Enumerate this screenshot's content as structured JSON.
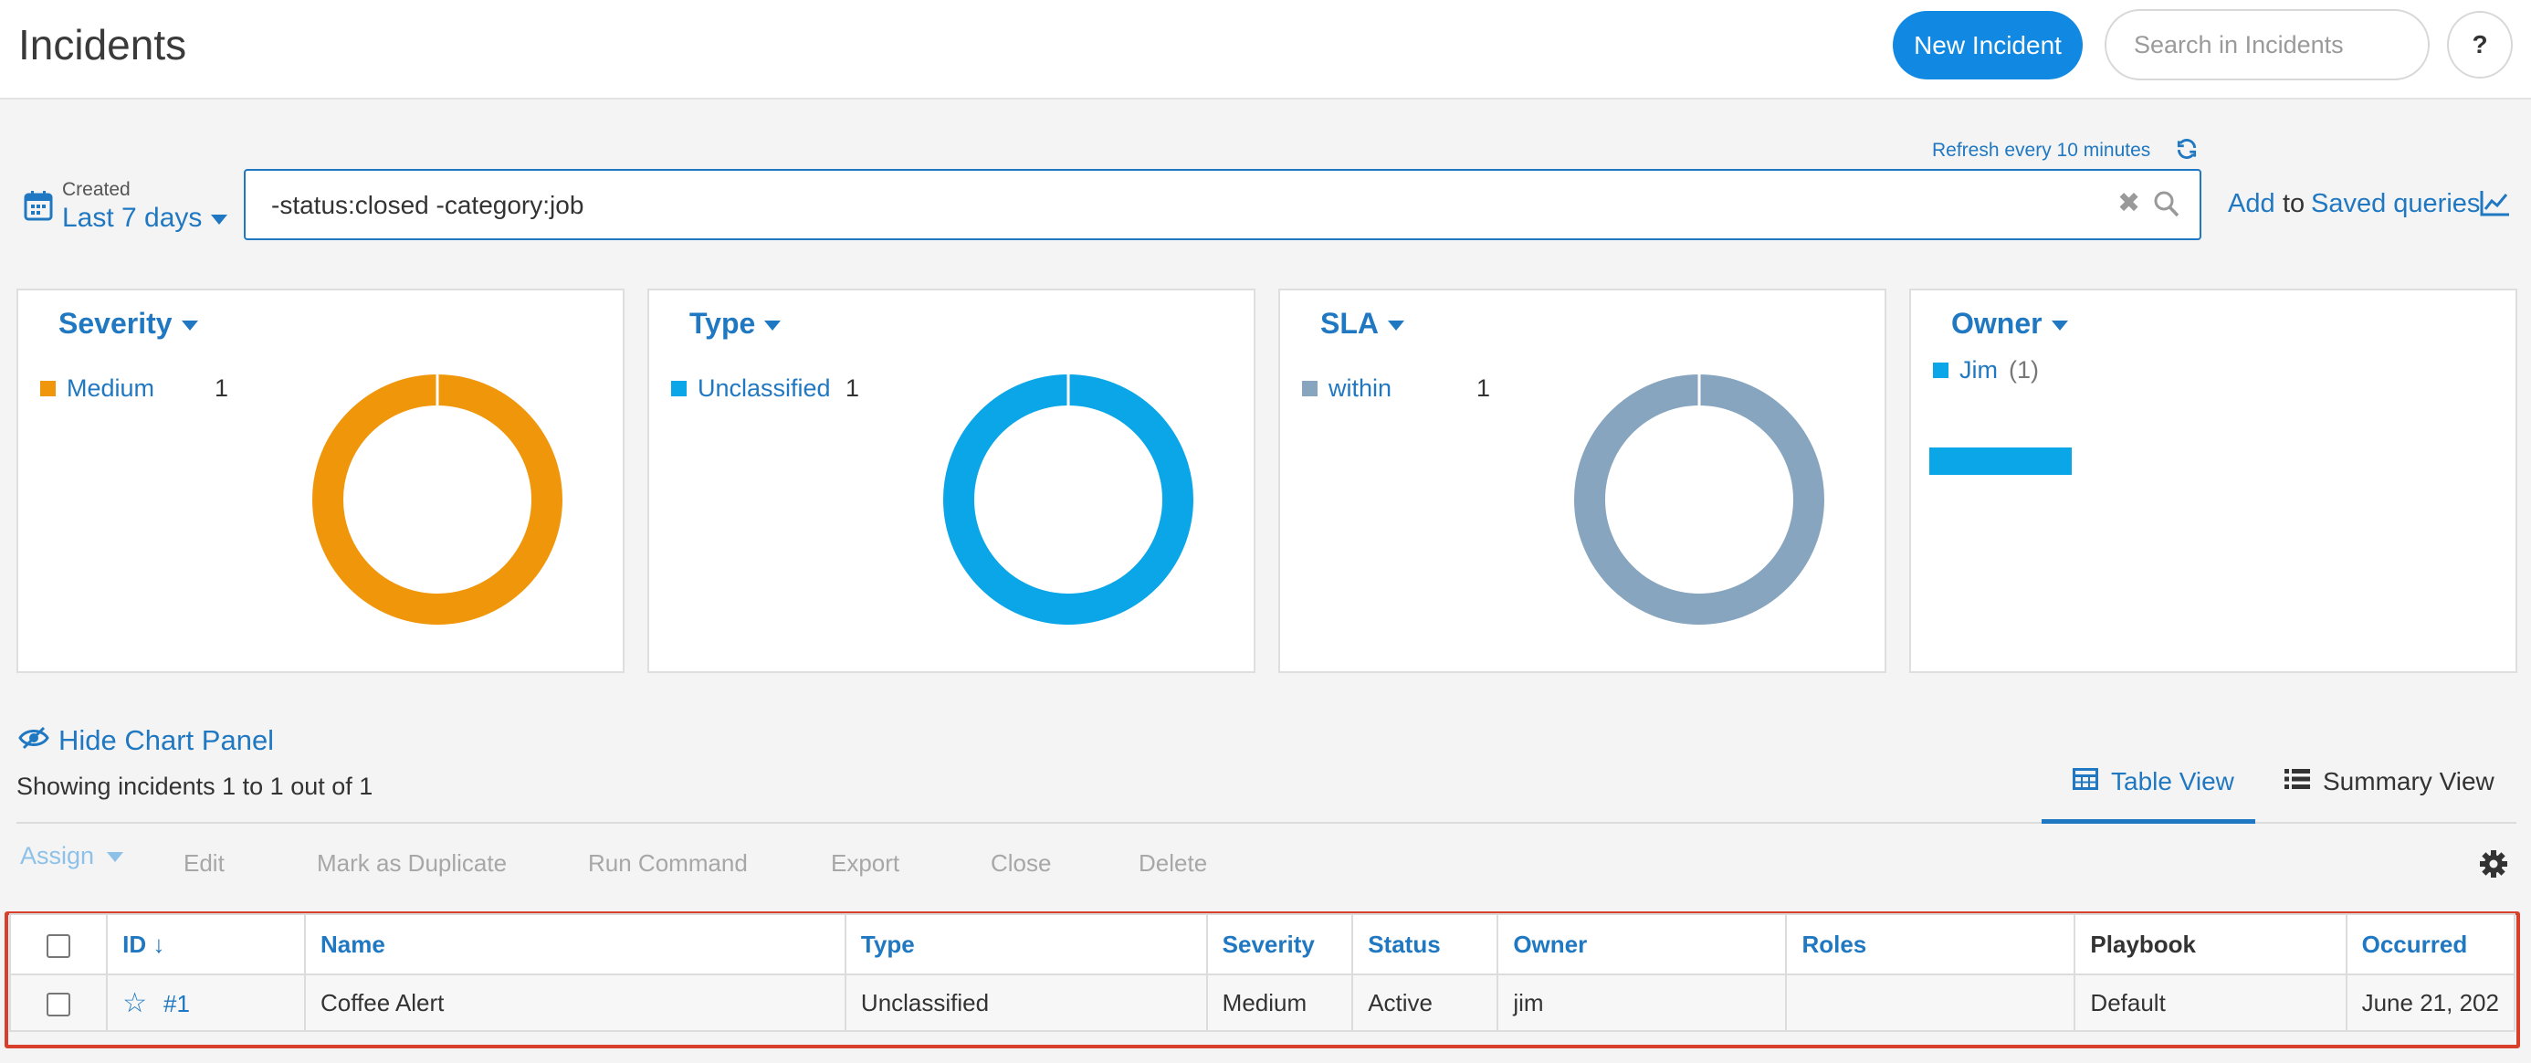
{
  "header": {
    "title": "Incidents",
    "new_button": "New Incident",
    "search_placeholder": "Search in Incidents",
    "help": "?"
  },
  "refresh": {
    "label": "Refresh every 10 minutes"
  },
  "filter": {
    "created_label": "Created",
    "created_value": "Last 7 days",
    "query": "-status:closed -category:job",
    "add": "Add",
    "to": "to",
    "saved_queries": "Saved queries"
  },
  "charts": [
    {
      "title": "Severity",
      "legend_label": "Medium",
      "legend_count": "1",
      "color": "#f0960a"
    },
    {
      "title": "Type",
      "legend_label": "Unclassified",
      "legend_count": "1",
      "color": "#0ba6e8"
    },
    {
      "title": "SLA",
      "legend_label": "within",
      "legend_count": "1",
      "color": "#88a5bf"
    },
    {
      "title": "Owner",
      "legend_label": "Jim",
      "legend_count": "(1)",
      "color": "#0ba6e8"
    }
  ],
  "panel_toggle": "Hide Chart Panel",
  "showing_text": "Showing incidents 1 to 1 out of 1",
  "views": {
    "table": "Table View",
    "summary": "Summary View"
  },
  "toolbar": {
    "assign": "Assign",
    "edit": "Edit",
    "duplicate": "Mark as Duplicate",
    "run": "Run Command",
    "export": "Export",
    "close": "Close",
    "delete": "Delete"
  },
  "table": {
    "columns": [
      "ID ↓",
      "Name",
      "Type",
      "Severity",
      "Status",
      "Owner",
      "Roles",
      "Playbook",
      "Occurred"
    ],
    "rows": [
      {
        "id": "#1",
        "name": "Coffee Alert",
        "type": "Unclassified",
        "severity": "Medium",
        "status": "Active",
        "owner": "jim",
        "roles": "",
        "playbook": "Default",
        "occurred": "June 21, 202"
      }
    ]
  }
}
